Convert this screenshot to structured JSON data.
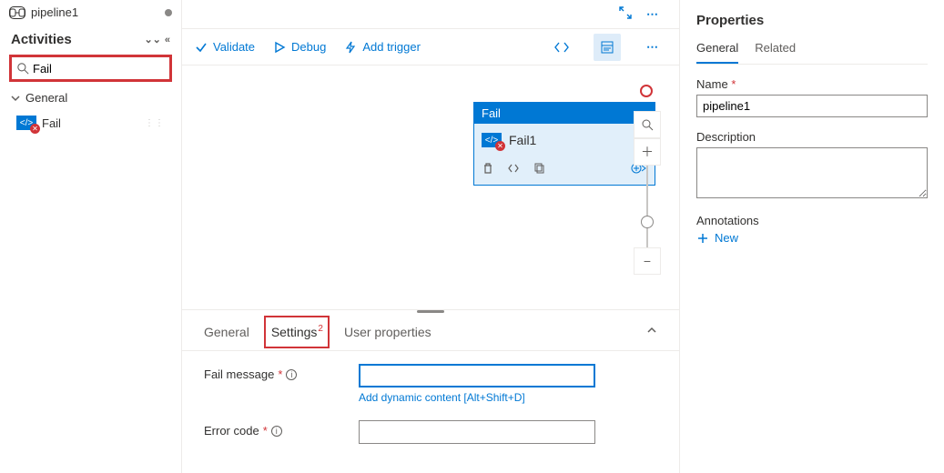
{
  "colors": {
    "accent": "#0078d4",
    "danger": "#d13438"
  },
  "title_tab": {
    "label": "pipeline1"
  },
  "sidebar": {
    "title": "Activities",
    "search_value": "Fail",
    "groups": [
      {
        "label": "General",
        "expanded": true
      }
    ],
    "activities": [
      {
        "label": "Fail"
      }
    ]
  },
  "toolbar": {
    "validate": "Validate",
    "debug": "Debug",
    "add_trigger": "Add trigger"
  },
  "canvas": {
    "node": {
      "type_label": "Fail",
      "name": "Fail1"
    }
  },
  "bottom_tabs": {
    "general": "General",
    "settings": "Settings",
    "settings_badge": "2",
    "user_properties": "User properties"
  },
  "settings_form": {
    "fail_message_label": "Fail message",
    "fail_message_value": "",
    "dynamic_content": "Add dynamic content [Alt+Shift+D]",
    "error_code_label": "Error code",
    "error_code_value": ""
  },
  "properties": {
    "heading": "Properties",
    "tabs": {
      "general": "General",
      "related": "Related"
    },
    "name_label": "Name",
    "name_value": "pipeline1",
    "description_label": "Description",
    "description_value": "",
    "annotations_label": "Annotations",
    "new_label": "New"
  }
}
